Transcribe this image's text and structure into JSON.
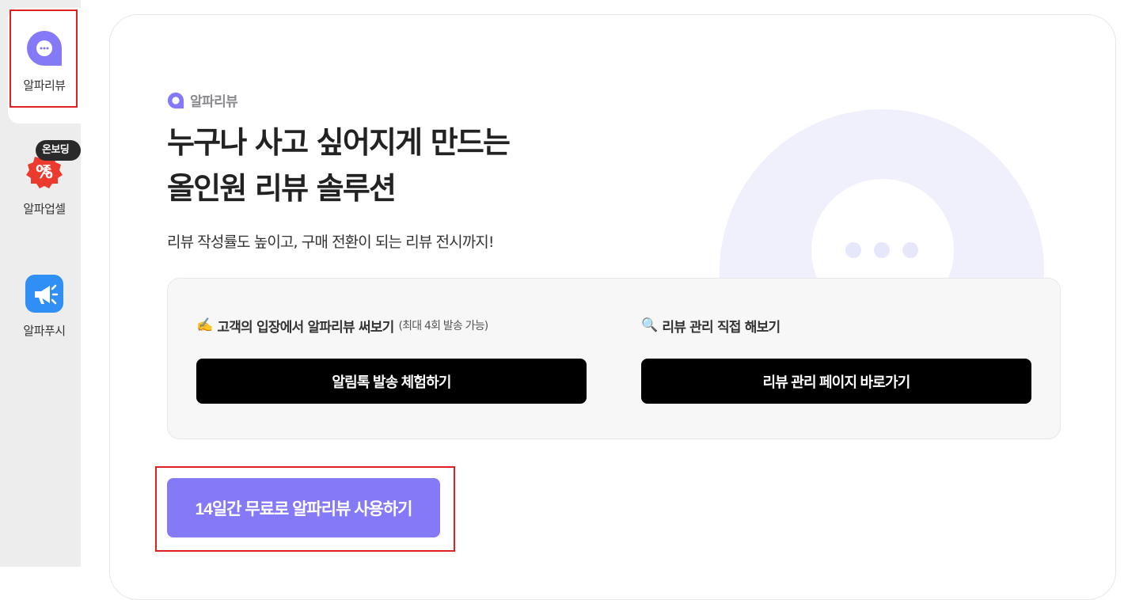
{
  "sidebar": {
    "items": [
      {
        "label": "알파리뷰",
        "icon": "alpha-review-icon",
        "active": true
      },
      {
        "label": "알파업셀",
        "icon": "percent-badge-icon",
        "badge": "온보딩중"
      },
      {
        "label": "알파푸시",
        "icon": "megaphone-icon"
      }
    ]
  },
  "main": {
    "brand": "알파리뷰",
    "headline_line1": "누구나 사고 싶어지게 만드는",
    "headline_line2": "올인원 리뷰 솔루션",
    "subline": "리뷰 작성률도 높이고, 구매 전환이 되는 리뷰 전시까지!",
    "panel": {
      "left": {
        "emoji": "✍️",
        "title": "고객의 입장에서 알파리뷰 써보기",
        "note": "(최대 4회 발송 가능)",
        "button": "알림톡 발송 체험하기"
      },
      "right": {
        "emoji": "🔍",
        "title": "리뷰 관리 직접 해보기",
        "button": "리뷰 관리 페이지 바로가기"
      }
    },
    "cta": "14일간 무료로 알파리뷰 사용하기"
  },
  "colors": {
    "accent": "#8479f7",
    "highlight": "#e02020",
    "upsell_red": "#ea3b2e",
    "push_blue": "#2f8ff5"
  }
}
